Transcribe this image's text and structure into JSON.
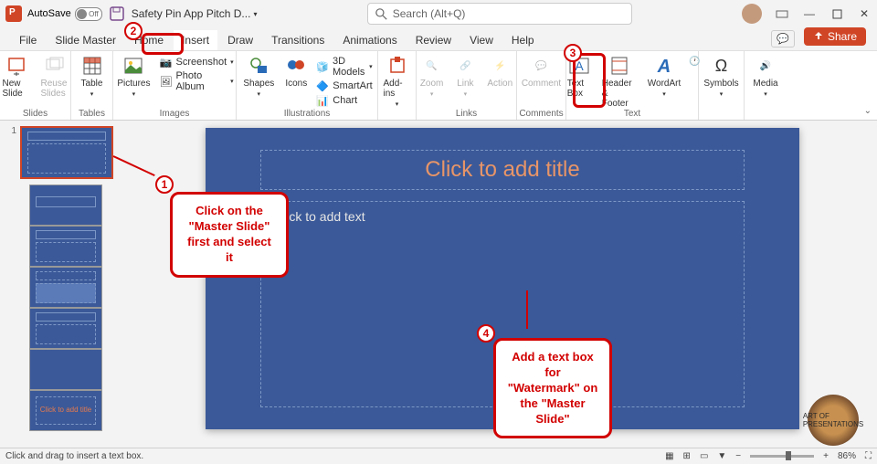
{
  "titlebar": {
    "autosave_label": "AutoSave",
    "autosave_state": "Off",
    "filename": "Safety Pin App Pitch D...",
    "search_placeholder": "Search (Alt+Q)"
  },
  "tabs": {
    "items": [
      "File",
      "Slide Master",
      "Home",
      "Insert",
      "Draw",
      "Transitions",
      "Animations",
      "Review",
      "View",
      "Help"
    ],
    "share": "Share"
  },
  "ribbon": {
    "slides": {
      "new_slide": "New Slide",
      "reuse": "Reuse Slides",
      "label": "Slides"
    },
    "tables": {
      "table": "Table",
      "label": "Tables"
    },
    "images": {
      "pictures": "Pictures",
      "screenshot": "Screenshot",
      "photo_album": "Photo Album",
      "label": "Images"
    },
    "illustrations": {
      "shapes": "Shapes",
      "icons": "Icons",
      "models": "3D Models",
      "smartart": "SmartArt",
      "chart": "Chart",
      "label": "Illustrations"
    },
    "addins": {
      "addins": "Add-ins",
      "label": ""
    },
    "links": {
      "zoom": "Zoom",
      "link": "Link",
      "action": "Action",
      "label": "Links"
    },
    "comments": {
      "comment": "Comment",
      "label": "Comments"
    },
    "text": {
      "textbox": "Text Box",
      "header": "Header & Footer",
      "wordart": "WordArt",
      "label": "Text"
    },
    "symbols": {
      "symbols": "Symbols",
      "label": ""
    },
    "media": {
      "media": "Media",
      "label": ""
    }
  },
  "slide": {
    "title_placeholder": "Click to add title",
    "body_placeholder": "Click to add text"
  },
  "thumbs": {
    "layout6_text": "Click to add title"
  },
  "annotations": {
    "n1": "1",
    "n2": "2",
    "n3": "3",
    "n4": "4",
    "callout1_l1": "Click on the",
    "callout1_l2": "\"Master Slide\"",
    "callout1_l3": "first and select it",
    "callout4_l1": "Add a text box for",
    "callout4_l2": "\"Watermark\" on",
    "callout4_l3": "the \"Master Slide\""
  },
  "status": {
    "text": "Click and drag to insert a text box.",
    "zoom": "86%"
  }
}
